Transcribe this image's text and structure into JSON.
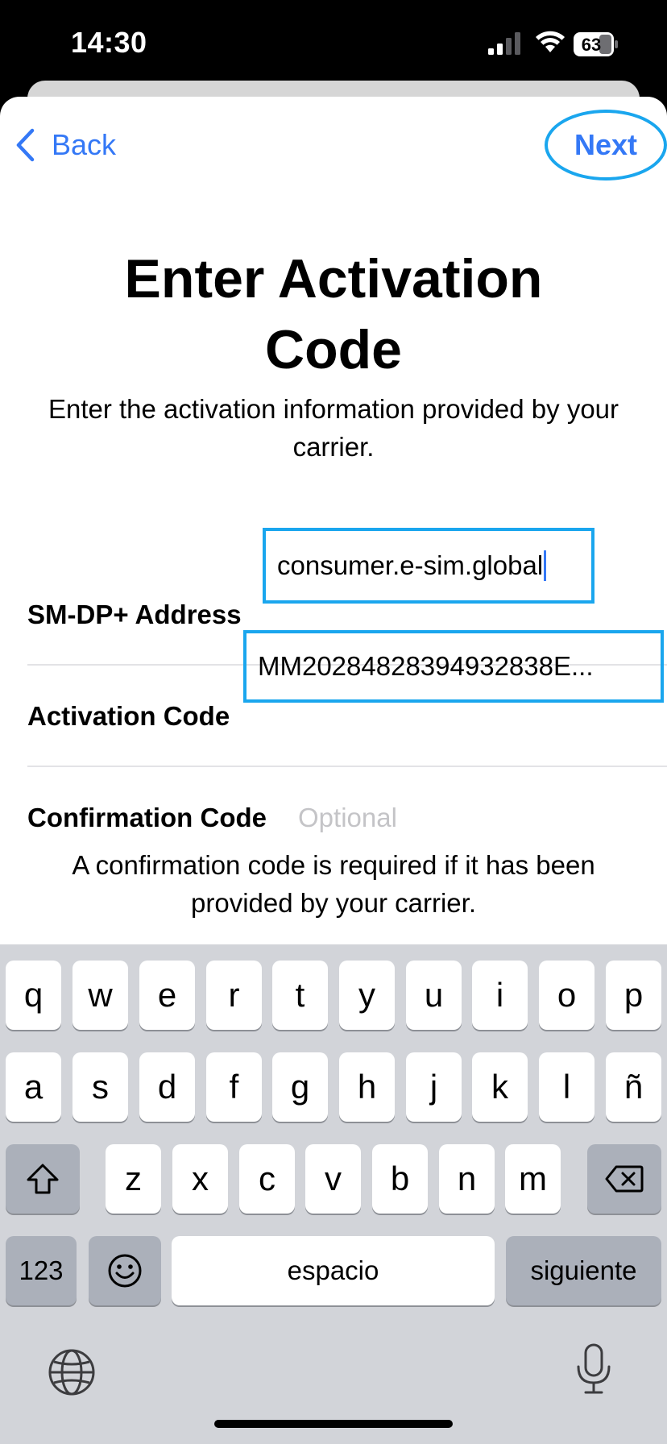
{
  "status_bar": {
    "time": "14:30",
    "battery": "63"
  },
  "nav": {
    "back_label": "Back",
    "next_label": "Next"
  },
  "page": {
    "title_line1": "Enter Activation",
    "title_line2": "Code",
    "subtitle": "Enter the activation information provided by your carrier."
  },
  "form": {
    "smdp_label": "SM-DP+ Address",
    "smdp_value": "consumer.e-sim.global",
    "activation_label": "Activation Code",
    "activation_value": "MM20284828394932838E...",
    "confirmation_label": "Confirmation Code",
    "confirmation_placeholder": "Optional"
  },
  "note": "A confirmation code is required if it has been provided by your carrier.",
  "keyboard": {
    "row1": [
      "q",
      "w",
      "e",
      "r",
      "t",
      "y",
      "u",
      "i",
      "o",
      "p"
    ],
    "row2": [
      "a",
      "s",
      "d",
      "f",
      "g",
      "h",
      "j",
      "k",
      "l",
      "ñ"
    ],
    "row3": [
      "z",
      "x",
      "c",
      "v",
      "b",
      "n",
      "m"
    ],
    "numbers_key": "123",
    "space_key": "espacio",
    "return_key": "siguiente"
  },
  "colors": {
    "accent": "#3478f6",
    "highlight": "#1aa6ee",
    "placeholder": "#c4c4c7"
  },
  "icons": {
    "back": "chevron-left-icon",
    "shift": "shift-arrow-icon",
    "delete": "backspace-icon",
    "emoji": "smiley-icon",
    "globe": "globe-icon",
    "mic": "microphone-icon"
  }
}
